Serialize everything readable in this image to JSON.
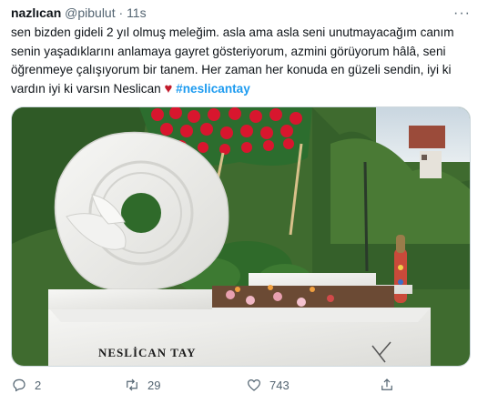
{
  "tweet": {
    "author_name": "nazlıcan",
    "author_handle": "@pibulut",
    "separator": "·",
    "time": "11s",
    "more_label": "···",
    "text_main": "sen bizden gideli 2 yıl olmuş meleğim. asla ama asla seni unutmayacağım canım senin yaşadıklarını anlamaya gayret gösteriyorum, azmini görüyorum hâlâ, seni öğrenmeye çalışıyorum bir tanem. Her zaman her konuda en güzeli sendin, iyi ki vardın iyi ki varsın Neslican",
    "emoji": "♥",
    "hashtag": "#neslicantay",
    "media": {
      "gravestone_inscription": "NESLİCAN TAY"
    }
  },
  "actions": {
    "reply_count": "2",
    "retweet_count": "29",
    "like_count": "743"
  },
  "colors": {
    "accent": "#1d9bf0",
    "text_secondary": "#536471",
    "heart": "#c21b2c"
  }
}
